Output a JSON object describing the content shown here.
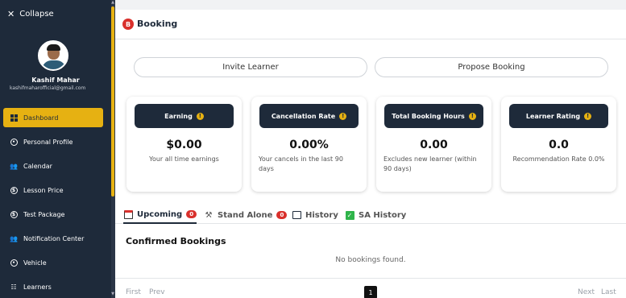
{
  "sidebar": {
    "collapse_label": "Collapse",
    "user_name": "Kashif Mahar",
    "user_email": "kashifmaharofficial@gmail.com",
    "items": [
      {
        "label": "Dashboard",
        "icon": "dashboard-icon",
        "active": true
      },
      {
        "label": "Personal Profile",
        "icon": "user-circle-icon"
      },
      {
        "label": "Calendar",
        "icon": "users-icon"
      },
      {
        "label": "Lesson Price",
        "icon": "dollar-icon"
      },
      {
        "label": "Test Package",
        "icon": "dollar-icon"
      },
      {
        "label": "Notification Center",
        "icon": "users-icon"
      },
      {
        "label": "Vehicle",
        "icon": "user-circle-icon"
      },
      {
        "label": "Learners",
        "icon": "learners-icon"
      }
    ]
  },
  "header": {
    "badge": "B",
    "title": "Booking"
  },
  "actions": {
    "invite": "Invite Learner",
    "propose": "Propose Booking"
  },
  "stats": [
    {
      "title": "Earning",
      "value": "$0.00",
      "sub": "Your all time earnings"
    },
    {
      "title": "Cancellation Rate",
      "value": "0.00%",
      "sub": "Your cancels in the last 90 days"
    },
    {
      "title": "Total Booking Hours",
      "value": "0.00",
      "sub": "Excludes new learner (within 90 days)"
    },
    {
      "title": "Learner Rating",
      "value": "0.0",
      "sub": "Recommendation Rate 0.0%"
    }
  ],
  "tabs": [
    {
      "label": "Upcoming",
      "count": "0"
    },
    {
      "label": "Stand Alone",
      "count": "0"
    },
    {
      "label": "History"
    },
    {
      "label": "SA History"
    }
  ],
  "section": {
    "title": "Confirmed Bookings",
    "empty": "No bookings found."
  },
  "pager": {
    "first": "First",
    "prev": "Prev",
    "page": "1",
    "next": "Next",
    "last": "Last"
  },
  "colors": {
    "sidebar": "#1e2a3a",
    "accent": "#e6b112",
    "badge": "#d9302c"
  }
}
